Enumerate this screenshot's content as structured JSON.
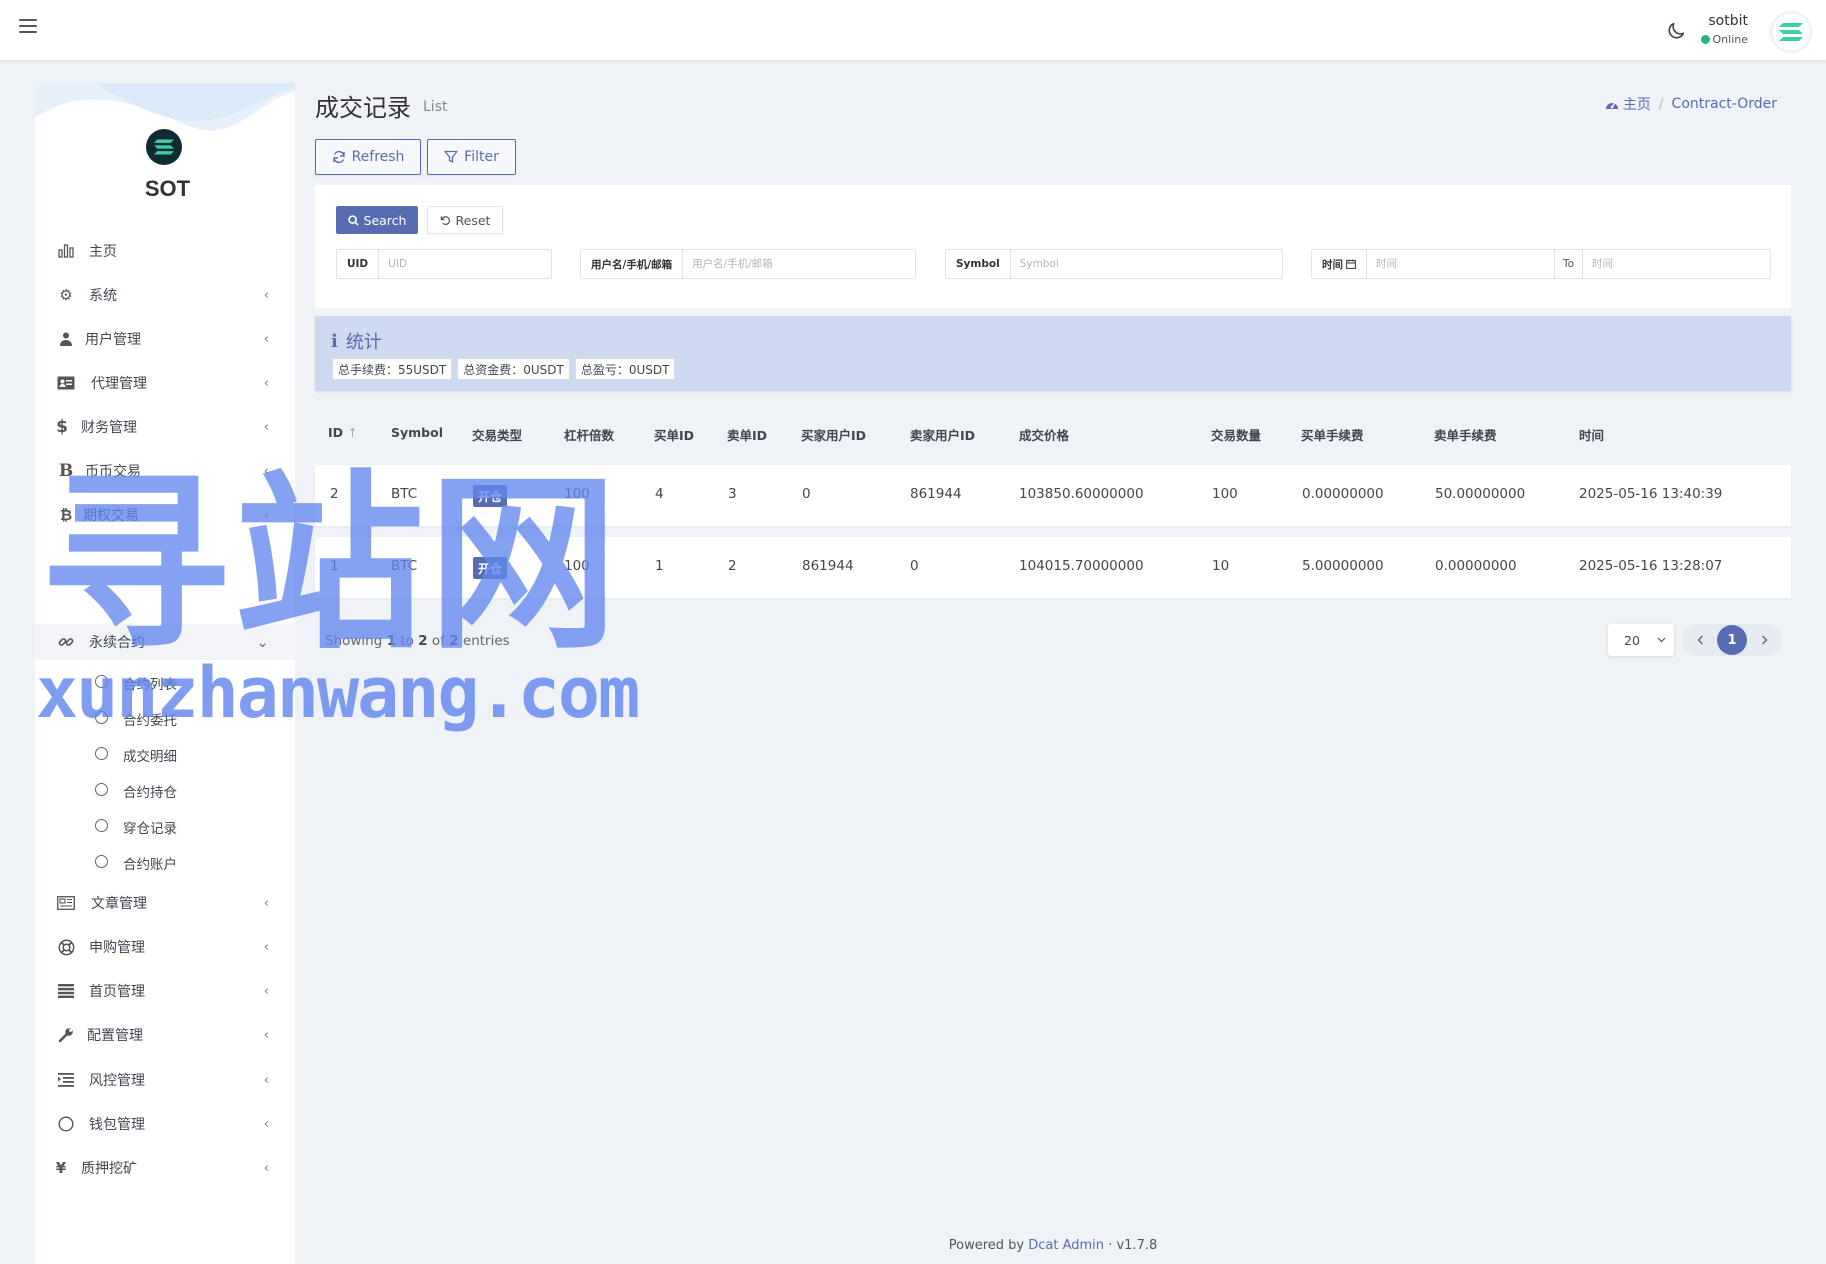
{
  "colors": {
    "accent": "#586cb1",
    "online": "#21b978",
    "stats_bg": "#cdd9ee",
    "page_bg": "#eff2f7"
  },
  "navbar": {
    "user_name": "sotbit",
    "user_status": "Online"
  },
  "sidebar": {
    "brand": "SOT",
    "items": [
      {
        "label": "主页",
        "icon": "bar-chart-icon"
      },
      {
        "label": "系统",
        "icon": "gear-icon",
        "arrow": "‹"
      },
      {
        "label": "用户管理",
        "icon": "users-icon",
        "arrow": "‹"
      },
      {
        "label": "代理管理",
        "icon": "id-card-icon",
        "arrow": "‹"
      },
      {
        "label": "财务管理",
        "icon": "dollar-icon",
        "arrow": "‹"
      },
      {
        "label": "币币交易",
        "icon": "bold-b-icon",
        "arrow": "‹"
      },
      {
        "label": "期权交易",
        "icon": "bitcoin-icon",
        "arrow": "‹"
      },
      {
        "label": "永续合约",
        "icon": "link-icon",
        "arrow": "⌄"
      },
      {
        "label": "文章管理",
        "icon": "newspaper-icon",
        "arrow": "‹"
      },
      {
        "label": "申购管理",
        "icon": "life-ring-icon",
        "arrow": "‹"
      },
      {
        "label": "首页管理",
        "icon": "list-bars-icon",
        "arrow": "‹"
      },
      {
        "label": "配置管理",
        "icon": "wrench-icon",
        "arrow": "‹"
      },
      {
        "label": "风控管理",
        "icon": "indent-icon",
        "arrow": "‹"
      },
      {
        "label": "钱包管理",
        "icon": "circle-icon",
        "arrow": "‹"
      },
      {
        "label": "质押挖矿",
        "icon": "yen-icon",
        "arrow": "‹"
      }
    ],
    "sub_items": [
      {
        "label": "合约列表"
      },
      {
        "label": "合约委托"
      },
      {
        "label": "成交明细"
      },
      {
        "label": "合约持仓"
      },
      {
        "label": "穿仓记录"
      },
      {
        "label": "合约账户"
      }
    ]
  },
  "header": {
    "title": "成交记录",
    "subtitle": "List"
  },
  "breadcrumb": {
    "home": "主页",
    "current": "Contract-Order"
  },
  "toolbar": {
    "refresh_label": "Refresh",
    "filter_label": "Filter"
  },
  "filters": {
    "search_label": "Search",
    "reset_label": "Reset",
    "uid": {
      "label": "UID",
      "placeholder": "UID",
      "value": ""
    },
    "user": {
      "label": "用户名/手机/邮箱",
      "placeholder": "用户名/手机/邮箱",
      "value": ""
    },
    "symbol": {
      "label": "Symbol",
      "placeholder": "Symbol",
      "value": ""
    },
    "time": {
      "label": "时间",
      "placeholder_start": "时间",
      "to_label": "To",
      "placeholder_end": "时间"
    }
  },
  "stats": {
    "title": "统计",
    "fee": "总手续费：55USDT",
    "funding": "总资金费：0USDT",
    "pnl": "总盈亏：0USDT"
  },
  "table": {
    "columns": [
      "ID",
      "Symbol",
      "交易类型",
      "杠杆倍数",
      "买单ID",
      "卖单ID",
      "买家用户ID",
      "卖家用户ID",
      "成交价格",
      "交易数量",
      "买单手续费",
      "卖单手续费",
      "时间"
    ],
    "rows": [
      {
        "id": "2",
        "symbol": "BTC",
        "type": "开仓",
        "leverage": "100",
        "buy_id": "4",
        "sell_id": "3",
        "buyer_uid": "0",
        "seller_uid": "861944",
        "price": "103850.60000000",
        "qty": "100",
        "buy_fee": "0.00000000",
        "sell_fee": "50.00000000",
        "time": "2025-05-16 13:40:39"
      },
      {
        "id": "1",
        "symbol": "BTC",
        "type": "开仓",
        "leverage": "100",
        "buy_id": "1",
        "sell_id": "2",
        "buyer_uid": "861944",
        "seller_uid": "0",
        "price": "104015.70000000",
        "qty": "10",
        "buy_fee": "5.00000000",
        "sell_fee": "0.00000000",
        "time": "2025-05-16 13:28:07"
      }
    ]
  },
  "pagination": {
    "showing_prefix": "Showing",
    "from": "1",
    "to_word": "to",
    "to": "2",
    "of_word": "of",
    "total": "2",
    "suffix": "entries",
    "per_page": "20",
    "current_page": "1"
  },
  "footer": {
    "prefix": "Powered by",
    "link": "Dcat Admin",
    "dot": "·",
    "version": "v1.7.8"
  },
  "watermark": {
    "big": "寻站网",
    "small": "xunzhanwang.com"
  }
}
